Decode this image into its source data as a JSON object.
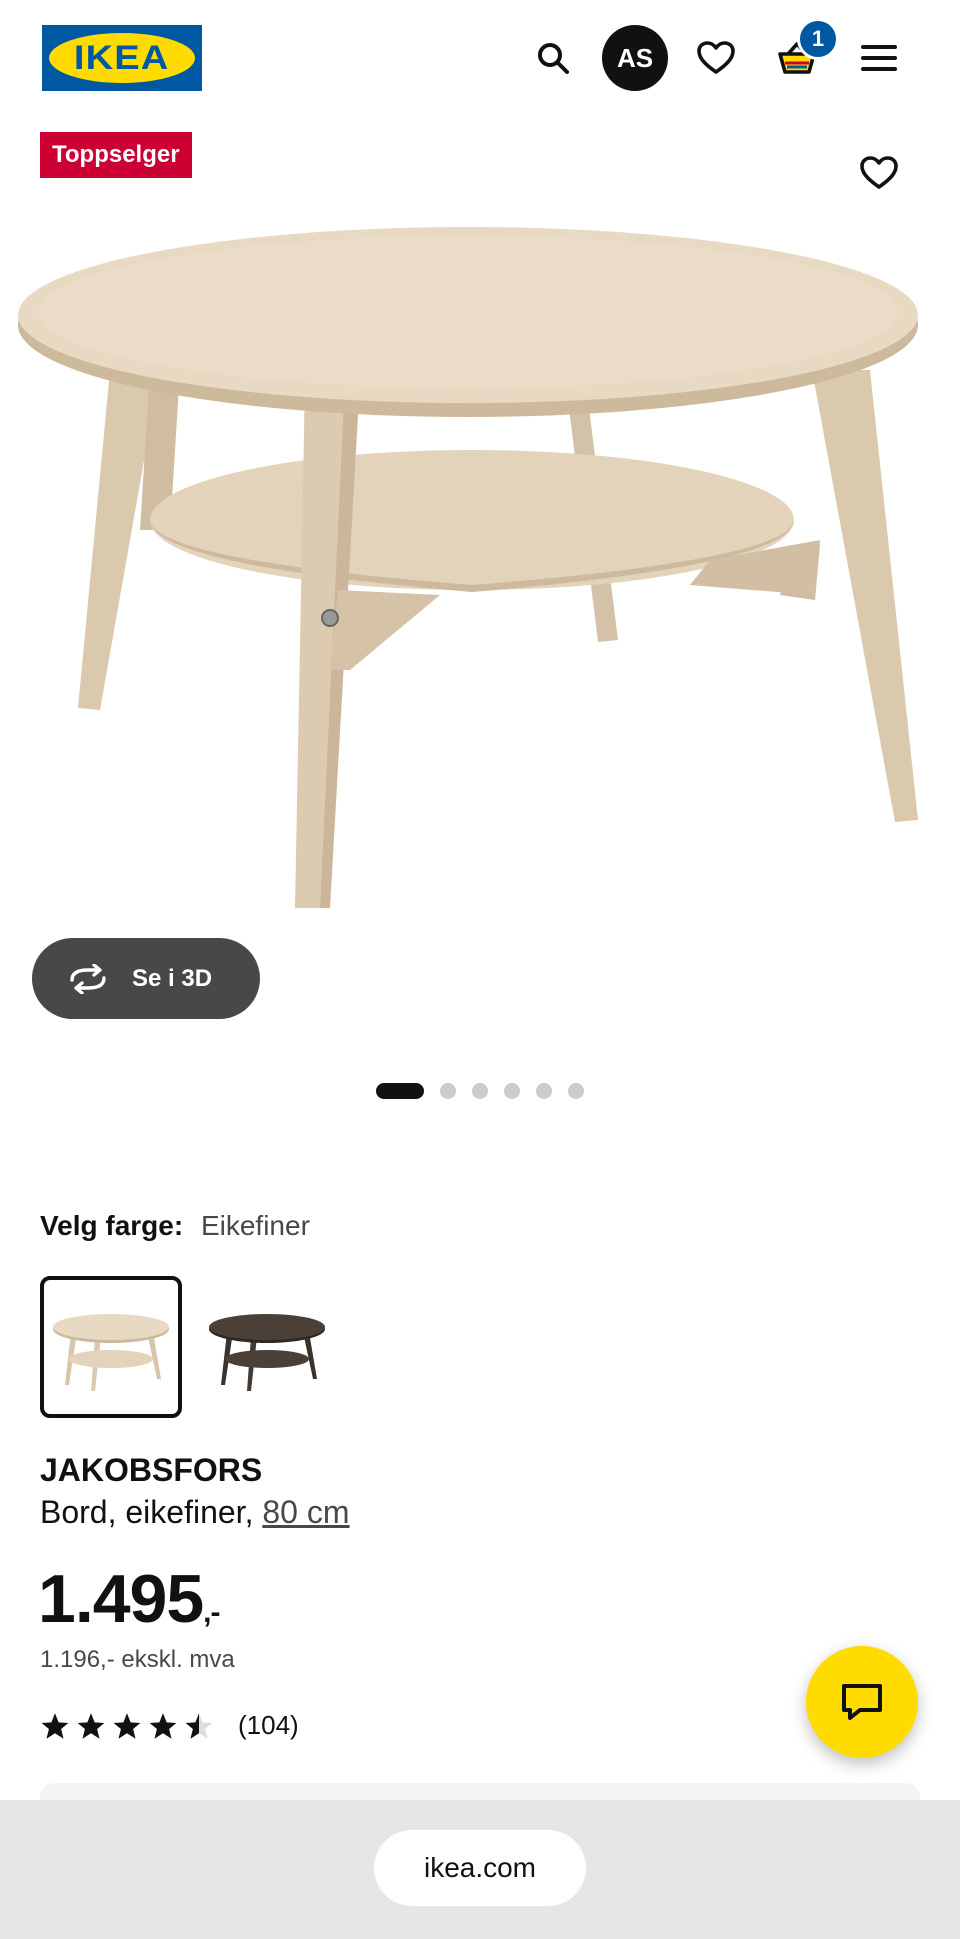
{
  "header": {
    "logo_text": "IKEA",
    "avatar_initials": "AS",
    "cart_count": "1",
    "icons": [
      "search-icon",
      "heart-icon",
      "cart-icon",
      "menu-icon"
    ],
    "colors": {
      "brand_blue": "#0058a3",
      "brand_yellow": "#ffdb00"
    }
  },
  "gallery": {
    "badge": "Toppselger",
    "view_3d_label": "Se i 3D",
    "image_count": 6,
    "active_index": 0
  },
  "color_selector": {
    "label": "Velg farge:",
    "selected_value": "Eikefiner",
    "options": [
      "light-oak",
      "dark-brown"
    ]
  },
  "product": {
    "name": "JAKOBSFORS",
    "description": "Bord, eikefiner, ",
    "size_link": "80 cm",
    "price_main": "1.495",
    "price_suffix": ",-",
    "price_ex_vat": "1.196,- ekskl. mva",
    "rating_stars": 4.5,
    "rating_count": "(104)"
  },
  "browser": {
    "url": "ikea.com"
  }
}
